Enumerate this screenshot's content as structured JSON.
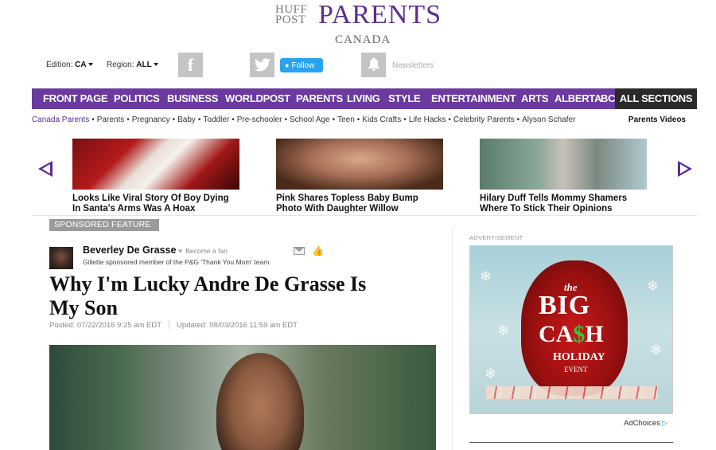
{
  "masthead": {
    "huff": "HUFF",
    "post": "POST",
    "parents": "PARENTS",
    "canada": "CANADA"
  },
  "edition_row": {
    "edition_label": "Edition:",
    "edition_value": "CA",
    "region_label": "Region:",
    "region_value": "ALL",
    "follow_label": "Follow",
    "newsletters_label": "Newsletters"
  },
  "nav": {
    "items": [
      "FRONT PAGE",
      "POLITICS",
      "BUSINESS",
      "WORLDPOST",
      "PARENTS",
      "LIVING",
      "STYLE",
      "ENTERTAINMENT",
      "ARTS",
      "ALBERTA",
      "BC"
    ],
    "all_sections": "ALL SECTIONS"
  },
  "subnav": {
    "items": [
      "Canada Parents",
      "Parents",
      "Pregnancy",
      "Baby",
      "Toddler",
      "Pre-schooler",
      "School Age",
      "Teen",
      "Kids Crafts",
      "Life Hacks",
      "Celebrity Parents",
      "Alyson Schafer"
    ],
    "videos": "Parents Videos"
  },
  "carousel": {
    "cards": [
      {
        "caption": "Looks Like Viral Story Of Boy Dying In Santa's Arms Was A Hoax"
      },
      {
        "caption": "Pink Shares Topless Baby Bump Photo With Daughter Willow"
      },
      {
        "caption": "Hilary Duff Tells Mommy Shamers Where To Stick Their Opinions"
      }
    ]
  },
  "article": {
    "sponsored": "SPONSORED FEATURE",
    "author": "Beverley De Grasse",
    "become_fan": "Become a fan",
    "author_bio": "Gillette sponsored member of the P&G 'Thank You Mom' team",
    "headline_line1": "Why I'm Lucky Andre De Grasse Is",
    "headline_line2": "My Son",
    "posted": "Posted: 07/22/2016 9:25 am EDT",
    "updated": "Updated: 08/03/2016 11:59 am EDT"
  },
  "sidebar": {
    "ad_label": "ADVERTISEMENT",
    "ad_the": "the",
    "ad_big": "BIG",
    "ad_cash_a": "CA",
    "ad_cash_dollar": "$",
    "ad_cash_b": "H",
    "ad_holiday": "HOLIDAY",
    "ad_event": "EVENT",
    "adchoices": "AdChoices"
  },
  "colors": {
    "brand_purple": "#6a3aa0",
    "nav_dark": "#2a2a2a",
    "twitter_blue": "#2aa3ef"
  }
}
